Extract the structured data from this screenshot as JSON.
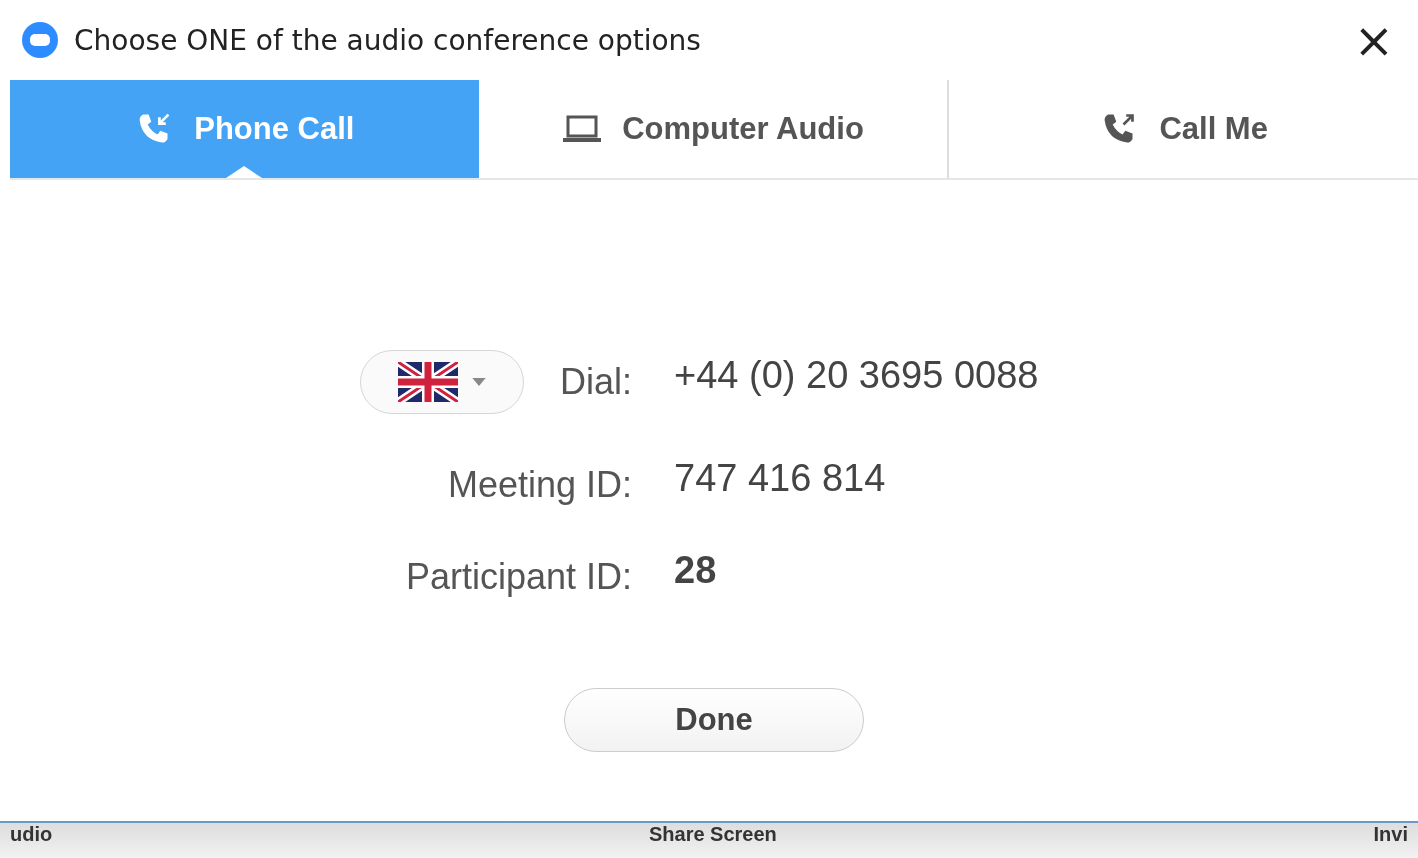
{
  "window": {
    "title": "Choose ONE of the audio conference options",
    "close": "×"
  },
  "tabs": [
    {
      "label": "Phone Call",
      "kind": "phone-in",
      "selected": true
    },
    {
      "label": "Computer Audio",
      "kind": "laptop",
      "selected": false
    },
    {
      "label": "Call Me",
      "kind": "phone-out",
      "selected": false
    }
  ],
  "details": [
    {
      "kind": "dial",
      "label": "Dial:",
      "value": "+44 (0) 20 3695 0088"
    },
    {
      "kind": "plain",
      "label": "Meeting ID:",
      "value": "747 416 814"
    },
    {
      "kind": "bold",
      "label": "Participant ID:",
      "value": "28"
    }
  ],
  "done_button": "Done",
  "toolbar_behind": [
    "udio",
    "Share Screen",
    "Invi"
  ]
}
